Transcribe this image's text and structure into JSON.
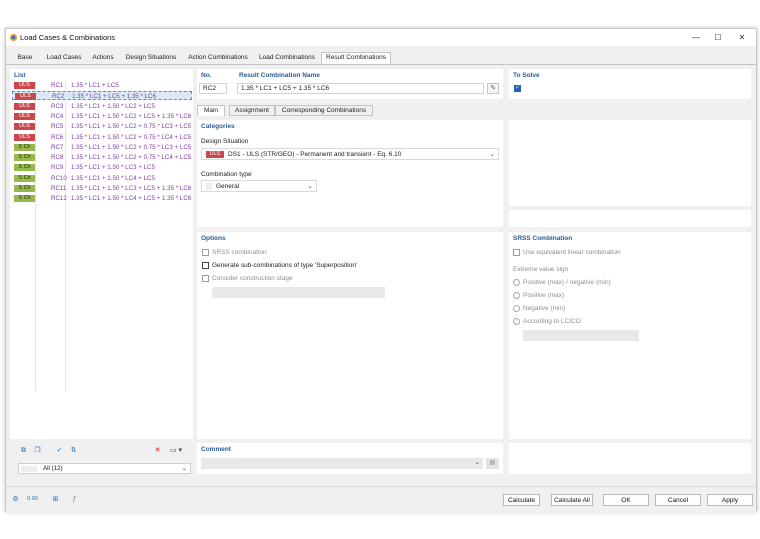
{
  "window": {
    "title": "Load Cases & Combinations"
  },
  "tabs": [
    "Base",
    "Load Cases",
    "Actions",
    "Design Situations",
    "Action Combinations",
    "Load Combinations",
    "Result Combinations"
  ],
  "list": {
    "header": "List",
    "rows": [
      {
        "type": "ULS",
        "id": "RC1",
        "text": "1.35 * LC1 + LC5"
      },
      {
        "type": "ULS",
        "id": "RC2",
        "text": "1.35 * LC1 + LC5 + 1.35 * LC6"
      },
      {
        "type": "ULS",
        "id": "RC3",
        "text": "1.35 * LC1 + 1.50 * LC2 + LC5"
      },
      {
        "type": "ULS",
        "id": "RC4",
        "text": "1.35 * LC1 + 1.50 * LC2 + LC5 + 1.35 * LC6"
      },
      {
        "type": "ULS",
        "id": "RC5",
        "text": "1.35 * LC1 + 1.50 * LC2 + 0.75 * LC3 + LC5"
      },
      {
        "type": "ULS",
        "id": "RC6",
        "text": "1.35 * LC1 + 1.50 * LC2 + 0.75 * LC4 + LC5"
      },
      {
        "type": "S Ch",
        "id": "RC7",
        "text": "1.35 * LC1 + 1.50 * LC2 + 0.75 * LC3 + LC5"
      },
      {
        "type": "S Ch",
        "id": "RC8",
        "text": "1.35 * LC1 + 1.50 * LC2 + 0.75 * LC4 + LC5"
      },
      {
        "type": "S Ch",
        "id": "RC9",
        "text": "1.35 * LC1 + 1.50 * LC3 + LC5"
      },
      {
        "type": "S Ch",
        "id": "RC10",
        "text": "1.35 * LC1 + 1.50 * LC4 + LC5"
      },
      {
        "type": "S Ch",
        "id": "RC11",
        "text": "1.35 * LC1 + 1.50 * LC3 + LC5 + 1.35 * LC6"
      },
      {
        "type": "S Ch",
        "id": "RC12",
        "text": "1.35 * LC1 + 1.50 * LC4 + LC5 + 1.35 * LC6"
      }
    ],
    "filter": "All (12)"
  },
  "header": {
    "no_label": "No.",
    "no_value": "RC2",
    "name_label": "Result Combination Name",
    "name_value": "1.35 * LC1 + LC5 + 1.35 * LC6",
    "to_solve_label": "To Solve",
    "to_solve_check": "✓"
  },
  "subtabs": [
    "Main",
    "Assignment",
    "Corresponding Combinations"
  ],
  "categories": {
    "title": "Categories",
    "design_situation_label": "Design Situation",
    "ds_badge": "ULS",
    "ds_value": "DS1 - ULS (STR/GEO) - Permanent and transient - Eq. 6.10",
    "combination_type_label": "Combination type",
    "combination_type_value": "General"
  },
  "options": {
    "title": "Options",
    "srss": "SRSS combination",
    "subcomb": "Generate sub-combinations of type 'Superposition'",
    "construction": "Consider construction stage"
  },
  "srss_panel": {
    "title": "SRSS Combination",
    "linear": "Use equivalent linear combination",
    "extreme_label": "Extreme value sign",
    "radios": [
      "Positive (max) / negative (min)",
      "Positive (max)",
      "Negative (min)",
      "According to LC/CO"
    ]
  },
  "comment": {
    "title": "Comment"
  },
  "buttons": {
    "calculate": "Calculate",
    "calculate_all": "Calculate All",
    "ok": "OK",
    "cancel": "Cancel",
    "apply": "Apply"
  },
  "colors": {
    "uls": "#c9484d",
    "sch": "#96b94e",
    "accent": "#2b5b92",
    "combo_text": "#8040a8"
  }
}
